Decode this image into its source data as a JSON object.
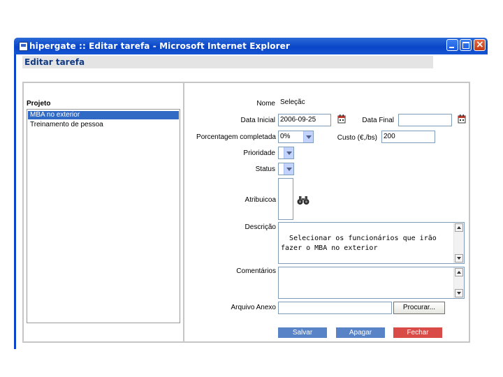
{
  "window": {
    "title": "hipergate :: Editar tarefa - Microsoft Internet Explorer"
  },
  "page": {
    "header": "Editar tarefa"
  },
  "project": {
    "label": "Projeto",
    "items": [
      "MBA no exterior",
      "Treinamento de pessoa"
    ],
    "selected_index": 0
  },
  "form": {
    "nome_label": "Nome",
    "nome_value": "Seleçãc",
    "data_inicial_label": "Data Inicial",
    "data_inicial_value": "2006-09-25",
    "data_final_label": "Data Final",
    "data_final_value": "",
    "porcentagem_label": "Porcentagem completada",
    "porcentagem_value": "0%",
    "custo_label": "Custo (€,/bs)",
    "custo_value": "200",
    "prioridade_label": "Prioridade",
    "prioridade_value": "",
    "status_label": "Status",
    "status_value": "",
    "atribuicao_label": "Atribuicoa",
    "descricao_label": "Descrição",
    "descricao_value": "Selecionar os funcionários que irão fazer o MBA no exterior",
    "comentarios_label": "Comentários",
    "comentarios_value": "",
    "arquivo_label": "Arquivo Anexo",
    "arquivo_value": "",
    "procurar_label": "Procurar..."
  },
  "actions": {
    "salvar": "Salvar",
    "apagar": "Apagar",
    "fechar": "Fechar"
  },
  "icons": {
    "calendar": "calendar-icon",
    "binoculars": "binoculars-icon"
  },
  "colors": {
    "titlebar": "#0a46c8",
    "selection": "#316ac5",
    "button_blue": "#5883c6",
    "button_red": "#d84b46",
    "header_text": "#113a82"
  }
}
